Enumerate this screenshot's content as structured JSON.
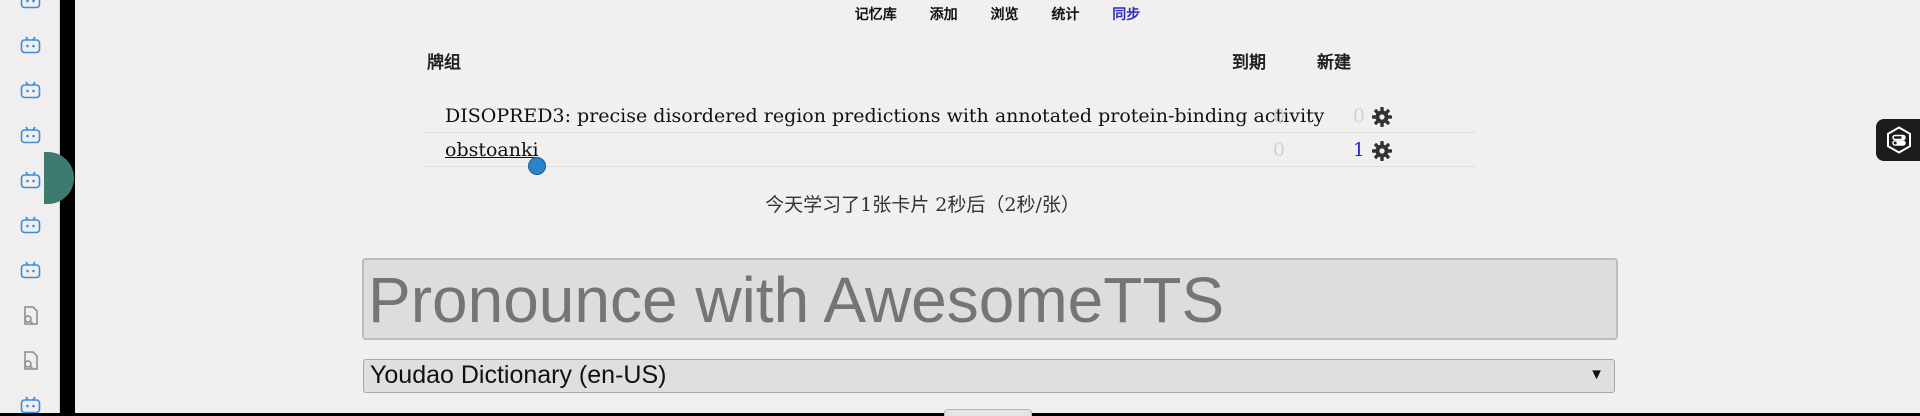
{
  "nav": {
    "items": [
      "记忆库",
      "添加",
      "浏览",
      "统计",
      "同步"
    ]
  },
  "deck_list": {
    "header": {
      "deck": "牌组",
      "due": "到期",
      "new": "新建"
    },
    "rows": [
      {
        "name": "DISOPRED3: precise disordered region predictions with annotated protein-binding activity",
        "due": "0",
        "new": "0"
      },
      {
        "name": "obstoanki",
        "due": "0",
        "new": "1"
      }
    ]
  },
  "stats": {
    "text": "今天学习了1张卡片 2秒后（2秒/张）"
  },
  "tts": {
    "placeholder": "Pronounce with AwesomeTTS",
    "voice": "Youdao Dictionary (en-US)",
    "arrow": "▼"
  },
  "icons": {
    "strip": [
      "bilibili-icon",
      "bilibili-icon",
      "bilibili-icon",
      "bilibili-icon",
      "bilibili-icon",
      "bilibili-icon",
      "bilibili-icon",
      "file-search-icon",
      "file-search-icon",
      "bilibili-icon"
    ],
    "deck_options": "gear-icon",
    "floating": "toggle-tool-icon"
  },
  "colors": {
    "link_blue": "#2d2ac4",
    "accent_green": "#3e7a6f",
    "icon_blue": "#3a8ed8"
  }
}
